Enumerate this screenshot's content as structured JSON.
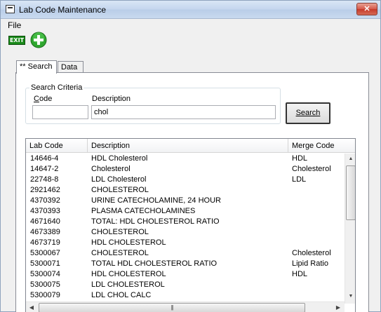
{
  "window": {
    "title": "Lab Code Maintenance",
    "close_glyph": "✕"
  },
  "menu": {
    "file": "File"
  },
  "toolbar": {
    "exit_label": "EXIT",
    "icons": [
      "exit-icon",
      "add-icon"
    ]
  },
  "tabs": [
    {
      "label": "** Search"
    },
    {
      "label": "Data"
    }
  ],
  "search_criteria": {
    "group_label": "Search Criteria",
    "code_label": "Code",
    "description_label": "Description",
    "code_value": "",
    "description_value": "chol",
    "search_button": "Search"
  },
  "results": {
    "columns": [
      "Lab Code",
      "Description",
      "Merge Code"
    ],
    "rows": [
      [
        "14646-4",
        "HDL Cholesterol",
        "HDL"
      ],
      [
        "14647-2",
        "Cholesterol",
        "Cholesterol"
      ],
      [
        "22748-8",
        "LDL Cholesterol",
        "LDL"
      ],
      [
        "2921462",
        "CHOLESTEROL",
        ""
      ],
      [
        "4370392",
        "URINE CATECHOLAMINE, 24 HOUR",
        ""
      ],
      [
        "4370393",
        "PLASMA CATECHOLAMINES",
        ""
      ],
      [
        "4671640",
        "TOTAL: HDL CHOLESTEROL RATIO",
        ""
      ],
      [
        "4673389",
        "CHOLESTEROL",
        ""
      ],
      [
        "4673719",
        "HDL CHOLESTEROL",
        ""
      ],
      [
        "5300067",
        "CHOLESTEROL",
        "Cholesterol"
      ],
      [
        "5300071",
        "TOTAL HDL CHOLESTEROL RATIO",
        "Lipid Ratio"
      ],
      [
        "5300074",
        "HDL CHOLESTEROL",
        "HDL"
      ],
      [
        "5300075",
        "LDL CHOLESTEROL",
        ""
      ],
      [
        "5300079",
        "LDL CHOL CALC",
        ""
      ]
    ]
  }
}
